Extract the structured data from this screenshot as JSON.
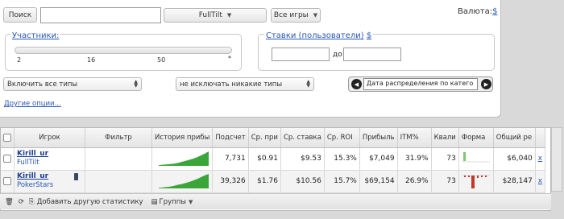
{
  "top": {
    "search_button": "Поиск",
    "site_select": "FullTilt",
    "games_button": "Все игры",
    "currency_label": "Валюта:",
    "currency_value": "$"
  },
  "participants": {
    "label": "Участники:",
    "ticks": [
      "2",
      "16",
      "50",
      "*"
    ]
  },
  "stakes": {
    "label": "Ставки (пользователи)",
    "currency": "$",
    "to_label": "до"
  },
  "filters": {
    "types_select": "Включить все типы",
    "exclude_select": "не исключать никакие типы",
    "distribution_field": "Дата распределения по катего",
    "more_options": "Другие опции..."
  },
  "table": {
    "headers": [
      "",
      "Игрок",
      "Фильтр",
      "История прибы",
      "Подсчет",
      "Ср. при",
      "Ср. ставка",
      "Ср. ROI",
      "Прибыль",
      "ITM%",
      "Квали",
      "Форма",
      "Общий ре",
      ""
    ],
    "rows": [
      {
        "player": "Kirill_ur",
        "site": "FullTilt",
        "count": "7,731",
        "avg_profit": "$0.91",
        "avg_stake": "$9.53",
        "roi": "15.3%",
        "profit": "$7,049",
        "itm": "31.9%",
        "quali": "73",
        "total": "$6,040",
        "remove": "x",
        "history": [
          0.05,
          0.08,
          0.1,
          0.12,
          0.15,
          0.2,
          0.28,
          0.35,
          0.42,
          0.5,
          0.6,
          0.72,
          0.85,
          1.0
        ]
      },
      {
        "player": "Kirill_ur",
        "site": "PokerStars",
        "count": "39,326",
        "avg_profit": "$1.76",
        "avg_stake": "$10.56",
        "roi": "15.7%",
        "profit": "$69,154",
        "itm": "26.9%",
        "quali": "73",
        "total": "$28,147",
        "remove": "x",
        "history": [
          0.04,
          0.06,
          0.1,
          0.13,
          0.18,
          0.25,
          0.3,
          0.38,
          0.45,
          0.55,
          0.65,
          0.78,
          0.9,
          1.0
        ]
      }
    ]
  },
  "footer": {
    "add_stat": "Добавить другую статистику",
    "groups": "Группы"
  },
  "colors": {
    "link": "#2a56b5",
    "chart_green": "#3aa63a",
    "form_red": "#c0392b",
    "form_green": "#7bc96f"
  }
}
